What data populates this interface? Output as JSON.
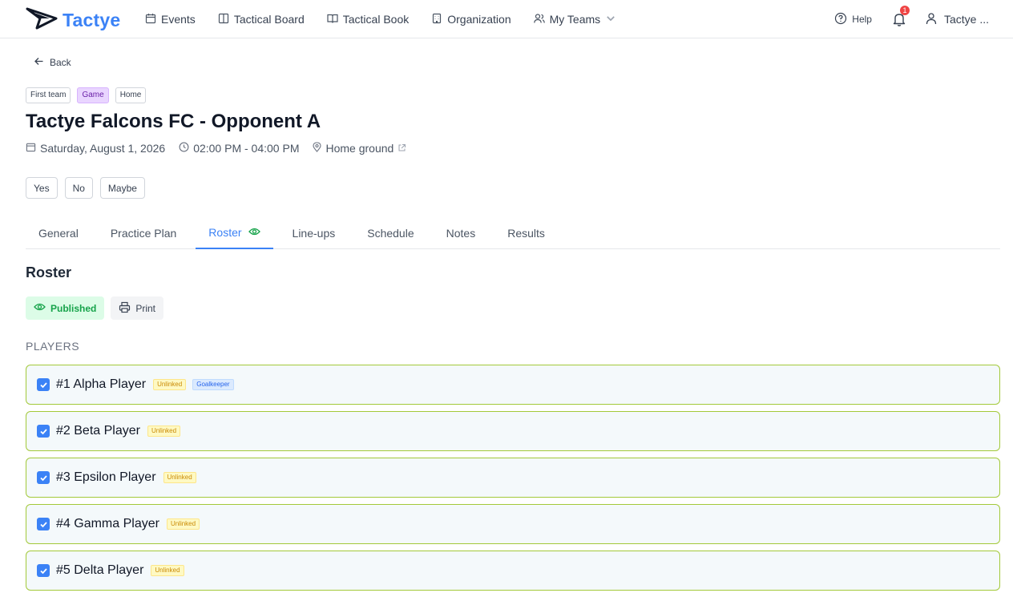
{
  "app": {
    "brand": "Tactye"
  },
  "nav": {
    "items": [
      {
        "label": "Events",
        "icon": "calendar-icon"
      },
      {
        "label": "Tactical Board",
        "icon": "board-icon"
      },
      {
        "label": "Tactical Book",
        "icon": "book-icon"
      },
      {
        "label": "Organization",
        "icon": "building-icon"
      },
      {
        "label": "My Teams",
        "icon": "users-icon"
      }
    ],
    "help_label": "Help",
    "notification_count": "1",
    "user_label": "Tactye ..."
  },
  "page": {
    "back_label": "Back",
    "tags": [
      "First team",
      "Game",
      "Home"
    ],
    "title": "Tactye Falcons FC - Opponent A",
    "date": "Saturday, August 1, 2026",
    "time": "02:00 PM - 04:00 PM",
    "location": "Home ground",
    "rsvp": [
      "Yes",
      "No",
      "Maybe"
    ]
  },
  "tabs": [
    {
      "label": "General"
    },
    {
      "label": "Practice Plan"
    },
    {
      "label": "Roster",
      "active": true
    },
    {
      "label": "Line-ups"
    },
    {
      "label": "Schedule"
    },
    {
      "label": "Notes"
    },
    {
      "label": "Results"
    }
  ],
  "roster": {
    "heading": "Roster",
    "published_label": "Published",
    "print_label": "Print",
    "players_label": "PLAYERS",
    "players": [
      {
        "name": "#1 Alpha Player",
        "chips": [
          "Unlinked",
          "Goalkeeper"
        ],
        "checked": true
      },
      {
        "name": "#2 Beta Player",
        "chips": [
          "Unlinked"
        ],
        "checked": true
      },
      {
        "name": "#3 Epsilon Player",
        "chips": [
          "Unlinked"
        ],
        "checked": true
      },
      {
        "name": "#4 Gamma Player",
        "chips": [
          "Unlinked"
        ],
        "checked": true
      },
      {
        "name": "#5 Delta Player",
        "chips": [
          "Unlinked"
        ],
        "checked": true
      }
    ]
  },
  "colors": {
    "accent": "#3b82f6",
    "published": "#16a34a",
    "row_border": "#a3c93a",
    "badge": "#ef4444"
  }
}
